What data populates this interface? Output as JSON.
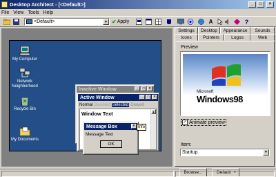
{
  "window": {
    "title": "Desktop Architect - [<Default>]",
    "minimize": "_",
    "maximize": "□",
    "close": "×"
  },
  "menu": [
    "File",
    "View",
    "Tools",
    "Help"
  ],
  "toolbar": {
    "scheme_value": "<Default>",
    "apply_label": "Apply"
  },
  "desktop": {
    "icons": [
      {
        "label": "My Computer",
        "icon": "computer-icon"
      },
      {
        "label": "Network Neighborhood",
        "icon": "network-icon"
      },
      {
        "label": "Recycle Bin",
        "icon": "recycle-bin-icon"
      },
      {
        "label": "My Documents",
        "icon": "documents-icon"
      }
    ],
    "inactive_window_title": "Inactive Window",
    "active_window_title": "Active Window",
    "menu_normal": "Normal",
    "menu_disabled": "Disabled",
    "menu_selected": "Selected",
    "menu_grayed": "Grayed",
    "window_text": "Window Text",
    "message_box_title": "Message Box",
    "message_text": "Message Text",
    "ok_label": "OK",
    "tooltip": "Info"
  },
  "tabs_row1": [
    "Settings",
    "Desktop",
    "Appearance",
    "Sounds"
  ],
  "tabs_row2": [
    "Icons",
    "Pointers",
    "Logos",
    "Web"
  ],
  "preview": {
    "label": "Preview",
    "logo_microsoft": "Microsoft",
    "logo_windows": "Windows98",
    "animate_label": "Animate preview",
    "animate_checked": true
  },
  "item": {
    "label": "Item:",
    "value": "Startup"
  },
  "buttons": {
    "browse": "Browse...",
    "default": "Default"
  },
  "colors": {
    "desktop": "#234e87",
    "titlebar_active": "#0a246a",
    "titlebar_inactive": "#808080"
  }
}
